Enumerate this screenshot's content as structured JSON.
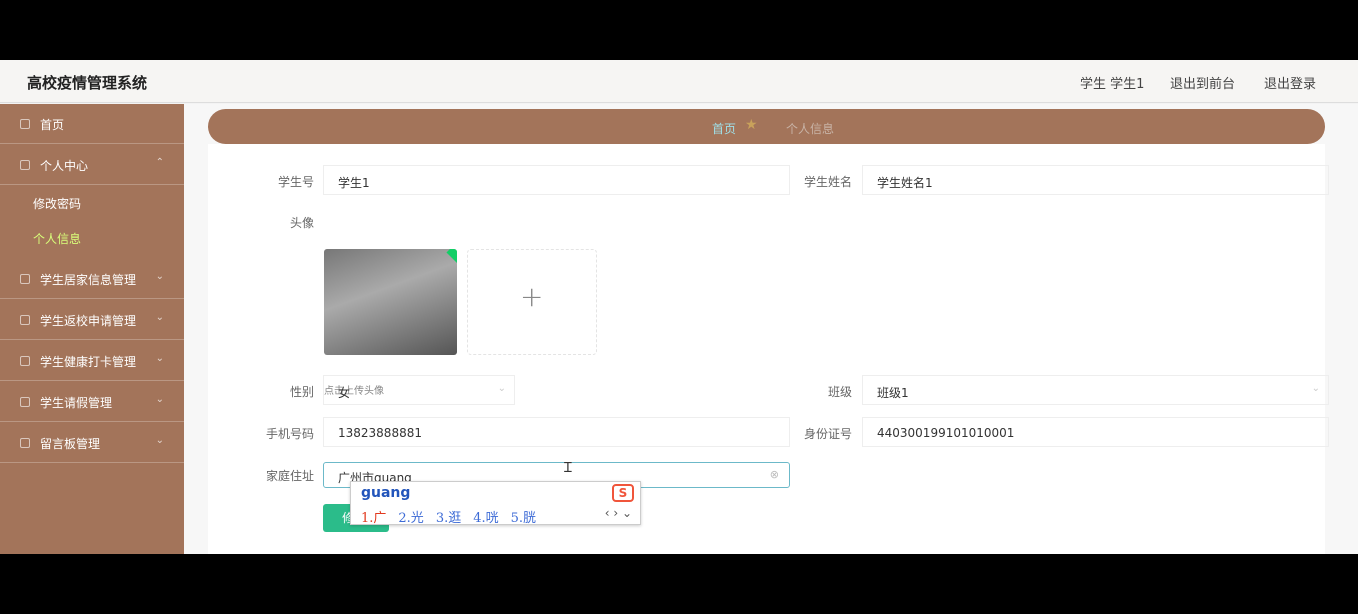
{
  "header": {
    "app_title": "高校疫情管理系统",
    "user_label": "学生 学生1",
    "back_front_label": "退出到前台",
    "logout_label": "退出登录"
  },
  "sidebar": {
    "items": [
      {
        "label": "首页"
      },
      {
        "label": "个人中心"
      },
      {
        "label": "学生居家信息管理"
      },
      {
        "label": "学生返校申请管理"
      },
      {
        "label": "学生健康打卡管理"
      },
      {
        "label": "学生请假管理"
      },
      {
        "label": "留言板管理"
      }
    ],
    "sub_items": [
      {
        "label": "修改密码"
      },
      {
        "label": "个人信息"
      }
    ]
  },
  "breadcrumb": {
    "home": "首页",
    "current": "个人信息"
  },
  "form": {
    "student_no_label": "学生号",
    "student_no_value": "学生1",
    "student_name_label": "学生姓名",
    "student_name_value": "学生姓名1",
    "avatar_label": "头像",
    "avatar_tip": "点击上传头像",
    "gender_label": "性别",
    "gender_value": "女",
    "class_label": "班级",
    "class_value": "班级1",
    "phone_label": "手机号码",
    "phone_value": "13823888881",
    "id_label": "身份证号",
    "id_value": "440300199101010001",
    "address_label": "家庭住址",
    "address_value": "广州市guang",
    "save_label": "修 改"
  },
  "ime": {
    "pinyin": "guang",
    "logo": "S",
    "candidates": [
      "1.广",
      "2.光",
      "3.逛",
      "4.咣",
      "5.胱"
    ],
    "nav": "‹ ›  ⌄"
  }
}
